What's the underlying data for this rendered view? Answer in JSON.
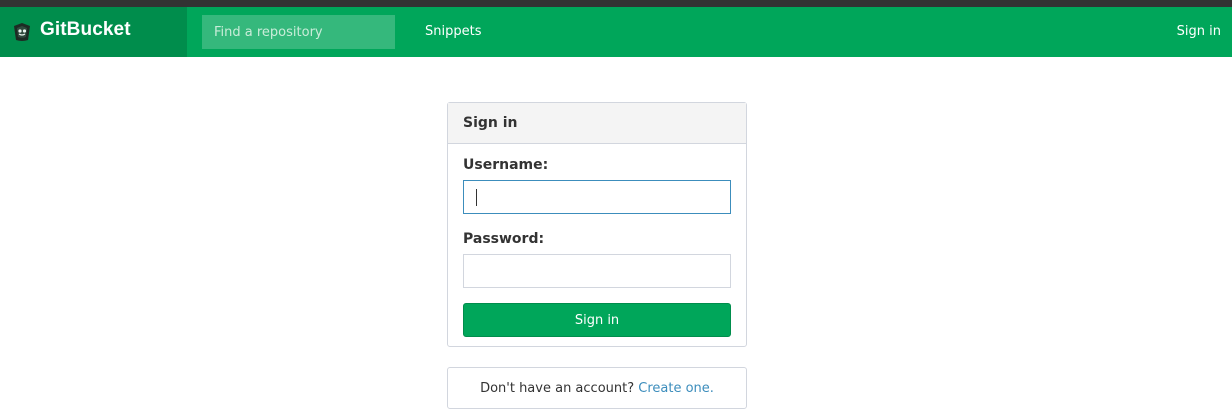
{
  "header": {
    "brand_name": "GitBucket",
    "logo_icon": "gitbucket-logo-icon",
    "search": {
      "placeholder": "Find a repository",
      "value": ""
    },
    "nav_links": [
      {
        "label": "Snippets"
      }
    ],
    "signin_label": "Sign in"
  },
  "signin_panel": {
    "title": "Sign in",
    "username_label": "Username:",
    "username_value": "",
    "password_label": "Password:",
    "password_value": "",
    "submit_label": "Sign in"
  },
  "signup": {
    "prompt": "Don't have an account?",
    "link_text": "Create one."
  },
  "colors": {
    "nav_green": "#00a65a",
    "brand_green": "#008d4c",
    "link_blue": "#3c8dbc",
    "topstrip": "#333333"
  }
}
